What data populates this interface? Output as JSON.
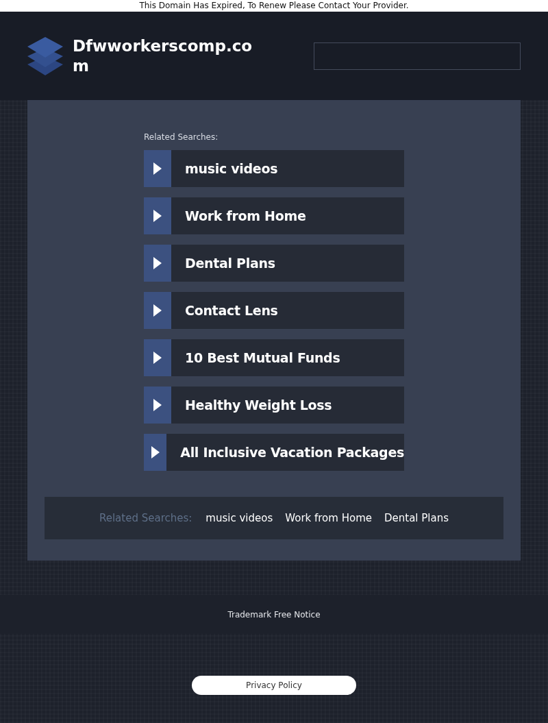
{
  "notice": "This Domain Has Expired, To Renew Please Contact Your Provider.",
  "header": {
    "domain": "Dfwworkerscomp.com"
  },
  "related": {
    "title": "Related Searches:",
    "links": [
      {
        "label": "music videos"
      },
      {
        "label": "Work from Home"
      },
      {
        "label": "Dental Plans"
      },
      {
        "label": "Contact Lens"
      },
      {
        "label": "10 Best Mutual Funds"
      },
      {
        "label": "Healthy Weight Loss"
      },
      {
        "label": "All Inclusive Vacation Packages"
      }
    ]
  },
  "bottom_bar": {
    "title": "Related Searches:",
    "links": [
      "music videos",
      "Work from Home",
      "Dental Plans"
    ]
  },
  "footer": {
    "notice": "Trademark Free Notice",
    "privacy": "Privacy Policy"
  }
}
